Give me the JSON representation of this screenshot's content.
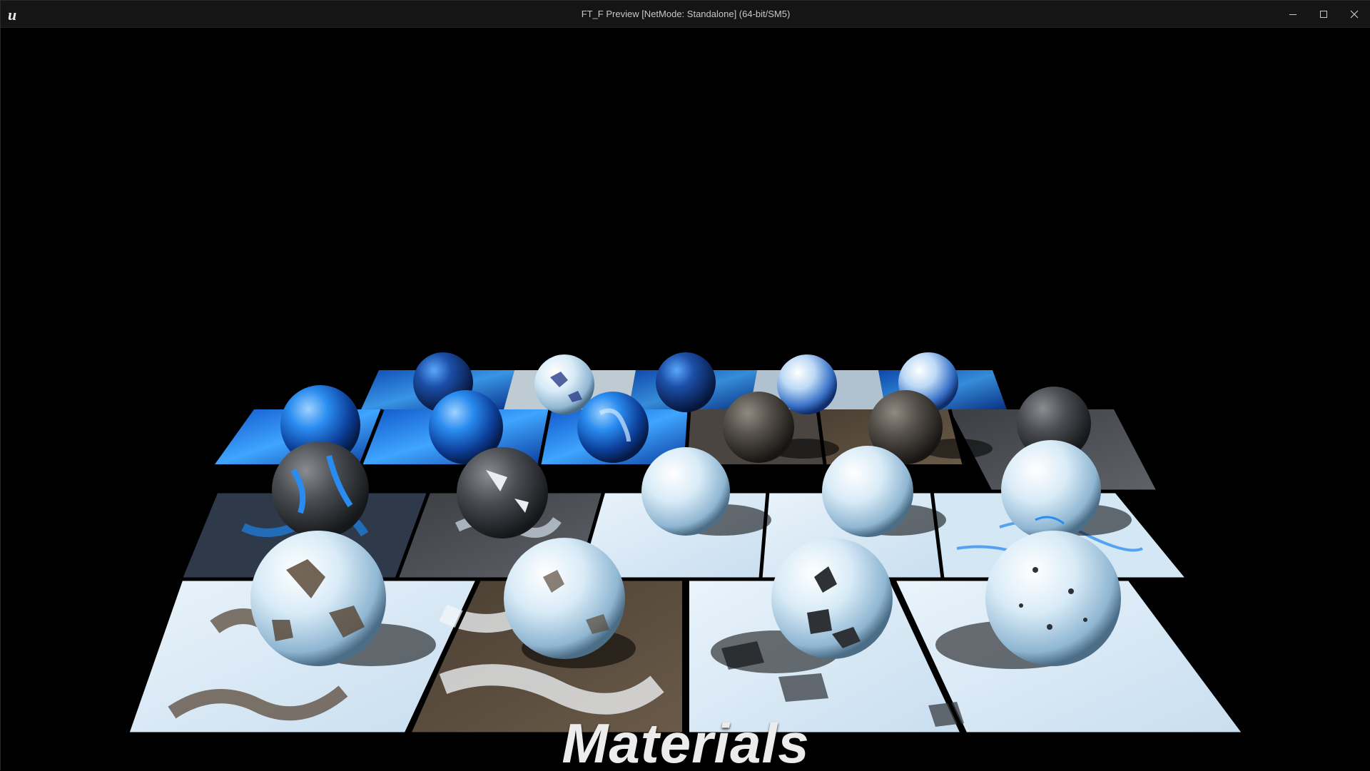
{
  "window": {
    "title": "FT_F Preview [NetMode: Standalone]  (64-bit/SM5)",
    "icons": {
      "logo": "unreal-logo-icon",
      "minimize": "minimize-icon",
      "maximize": "maximize-icon",
      "close": "close-icon"
    }
  },
  "viewport": {
    "caption": "Materials",
    "colors": {
      "background": "#000000",
      "ice_blue": "#1f7fe0",
      "snow_white": "#dfeef8",
      "rock_gray": "#4a4d52",
      "dirt_brown": "#5a4a3a"
    }
  }
}
